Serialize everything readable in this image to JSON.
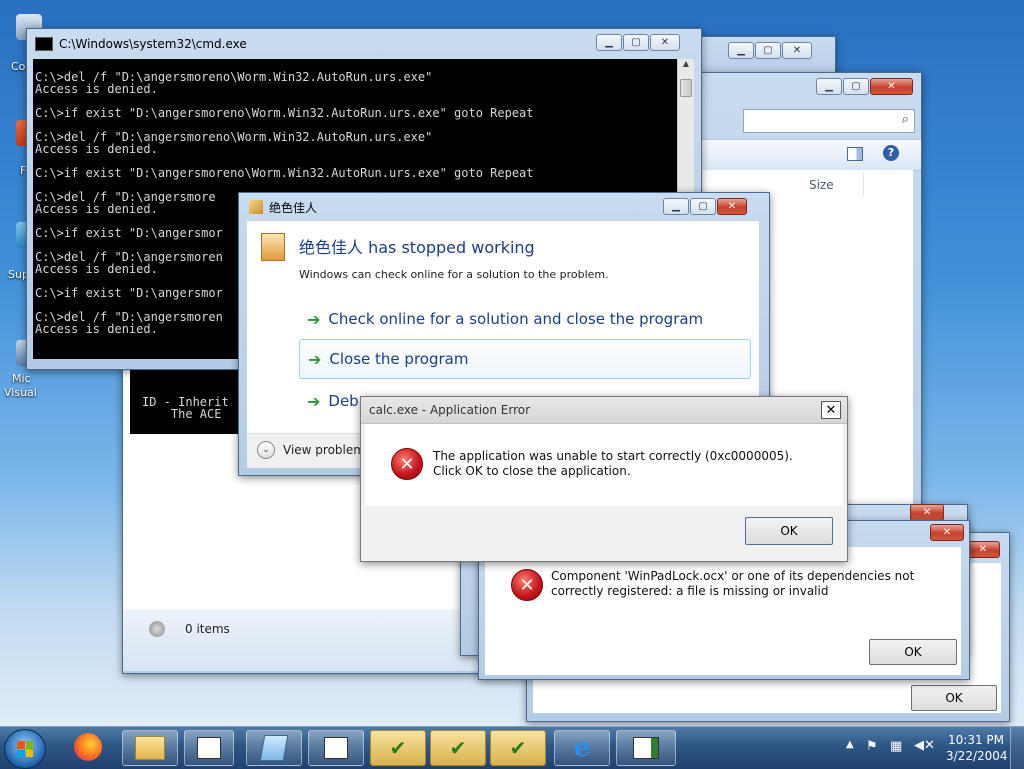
{
  "desktop": {
    "icon_labels": [
      "Co",
      "F",
      "Sup",
      "Mic",
      "Visual"
    ]
  },
  "cmd": {
    "title": "C:\\Windows\\system32\\cmd.exe",
    "lines": [
      "C:\\>del /f \"D:\\angersmoreno\\Worm.Win32.AutoRun.urs.exe\"",
      "Access is denied.",
      "",
      "C:\\>if exist \"D:\\angersmoreno\\Worm.Win32.AutoRun.urs.exe\" goto Repeat",
      "",
      "C:\\>del /f \"D:\\angersmoreno\\Worm.Win32.AutoRun.urs.exe\"",
      "Access is denied.",
      "",
      "C:\\>if exist \"D:\\angersmoreno\\Worm.Win32.AutoRun.urs.exe\" goto Repeat",
      "",
      "C:\\>del /f \"D:\\angersmore",
      "Access is denied.",
      "",
      "C:\\>if exist \"D:\\angersmor",
      "",
      "C:\\>del /f \"D:\\angersmoren",
      "Access is denied.",
      "",
      "C:\\>if exist \"D:\\angersmor",
      "",
      "C:\\>del /f \"D:\\angersmoren",
      "Access is denied."
    ]
  },
  "cmd2": {
    "lines": [
      "ID - Inherit",
      "    The ACE"
    ]
  },
  "explorer": {
    "column_size": "Size",
    "status_items": "0 items"
  },
  "wer": {
    "title": "绝色佳人",
    "heading": "绝色佳人 has stopped working",
    "subtext": "Windows can check online for a solution to the problem.",
    "option1": "Check online for a solution and close the program",
    "option2": "Close the program",
    "option3": "Deb",
    "details": "View problem"
  },
  "calc_error": {
    "title": "calc.exe - Application Error",
    "message": "The application was unable to start correctly (0xc0000005). Click OK to close the application.",
    "ok": "OK"
  },
  "component_error": {
    "message": "Component 'WinPadLock.ocx' or one of its dependencies not correctly registered: a file is missing or invalid",
    "ok": "OK"
  },
  "back_dialog": {
    "ok": "OK"
  },
  "taskbar": {
    "time": "10:31 PM",
    "date": "3/22/2004"
  },
  "colors": {
    "accent_link": "#1a3e8c",
    "error_red": "#c4121a"
  }
}
